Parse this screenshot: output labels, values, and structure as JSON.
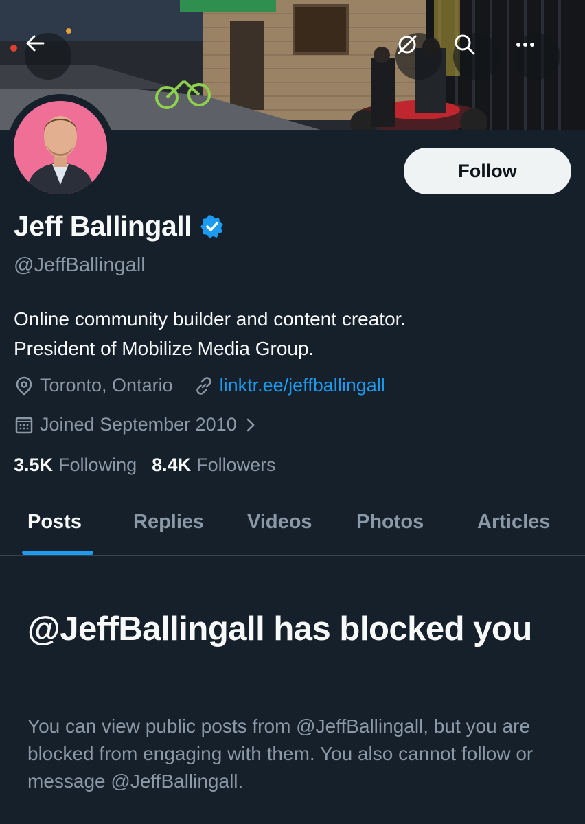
{
  "header": {
    "back_icon": "arrow-left-icon",
    "icons": [
      "grok-icon",
      "search-icon",
      "more-icon"
    ]
  },
  "profile": {
    "follow_label": "Follow",
    "display_name": "Jeff Ballingall",
    "handle": "@JeffBallingall",
    "bio_line1": "Online community builder and content creator.",
    "bio_line2": "President of Mobilize Media Group.",
    "location": "Toronto, Ontario",
    "website": "linktr.ee/jeffballingall",
    "joined": "Joined September 2010",
    "following_count": "3.5K",
    "following_label": "Following",
    "followers_count": "8.4K",
    "followers_label": "Followers"
  },
  "tabs": [
    {
      "label": "Posts"
    },
    {
      "label": "Replies"
    },
    {
      "label": "Videos"
    },
    {
      "label": "Photos"
    },
    {
      "label": "Articles"
    }
  ],
  "blocked": {
    "title": "@JeffBallingall has blocked you",
    "message": "You can view public posts from @JeffBallingall, but you are blocked from engaging with them. You also cannot follow or message @JeffBallingall."
  },
  "colors": {
    "background": "#15202b",
    "accent": "#1d9bf0",
    "secondary_text": "#8b98a5",
    "avatar_bg": "#ef6f96"
  }
}
